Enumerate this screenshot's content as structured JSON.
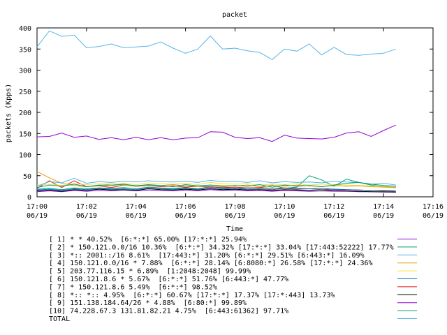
{
  "chart_data": {
    "type": "line",
    "title": "packet",
    "xlabel": "Time",
    "ylabel": "packets (Kpps)",
    "ylim": [
      0,
      400
    ],
    "yticks": [
      "0",
      "50",
      "100",
      "150",
      "200",
      "250",
      "300",
      "350",
      "400"
    ],
    "xlim": [
      "17:00",
      "17:16"
    ],
    "xticks": [
      {
        "time": "17:00",
        "date": "06/19"
      },
      {
        "time": "17:02",
        "date": "06/19"
      },
      {
        "time": "17:04",
        "date": "06/19"
      },
      {
        "time": "17:06",
        "date": "06/19"
      },
      {
        "time": "17:08",
        "date": "06/19"
      },
      {
        "time": "17:10",
        "date": "06/19"
      },
      {
        "time": "17:12",
        "date": "06/19"
      },
      {
        "time": "17:14",
        "date": "06/19"
      },
      {
        "time": "17:16",
        "date": "06/19"
      }
    ],
    "x": [
      "17:00:00",
      "17:00:30",
      "17:01:00",
      "17:01:30",
      "17:02:00",
      "17:02:30",
      "17:03:00",
      "17:03:30",
      "17:04:00",
      "17:04:30",
      "17:05:00",
      "17:05:30",
      "17:06:00",
      "17:06:30",
      "17:07:00",
      "17:07:30",
      "17:08:00",
      "17:08:30",
      "17:09:00",
      "17:09:30",
      "17:10:00",
      "17:10:30",
      "17:11:00",
      "17:11:30",
      "17:12:00",
      "17:12:30",
      "17:13:00",
      "17:13:30",
      "17:14:00",
      "17:14:30"
    ],
    "grid": false,
    "legend_position": "bottom",
    "series": [
      {
        "name": "[ 1] * * 40.52%  [6:*:*] 65.00% [17:*:*] 25.94%",
        "color": "#9400d3",
        "values": [
          142,
          143,
          151,
          141,
          144,
          136,
          140,
          135,
          141,
          135,
          140,
          135,
          139,
          140,
          154,
          153,
          141,
          138,
          140,
          131,
          146,
          139,
          138,
          137,
          141,
          151,
          154,
          143,
          157,
          170
        ]
      },
      {
        "name": "[ 2] * 150.121.0.0/16 10.36%  [6:*:*] 34.32% [17:*:*] 33.04% [17:443:52222] 17.77%",
        "color": "#009e73",
        "values": [
          22,
          28,
          25,
          30,
          24,
          28,
          27,
          30,
          26,
          29,
          27,
          24,
          29,
          26,
          28,
          24,
          27,
          25,
          29,
          23,
          28,
          25,
          27,
          24,
          28,
          32,
          34,
          30,
          27,
          25
        ]
      },
      {
        "name": "[ 3] *:: 2001::/16 8.61%  [17:443:*] 31.20% [6:*:*] 29.51% [6:443:*] 16.09%",
        "color": "#56b4e9",
        "values": [
          25,
          36,
          33,
          44,
          32,
          36,
          34,
          37,
          35,
          38,
          36,
          35,
          37,
          34,
          39,
          36,
          37,
          34,
          38,
          33,
          36,
          34,
          35,
          33,
          37,
          35,
          34,
          30,
          32,
          28
        ]
      },
      {
        "name": "[ 4] 150.121.0.0/16 * 7.88%  [6:*:*] 28.14% [6:8080:*] 26.58% [17:*:*] 24.36%",
        "color": "#e69f00",
        "values": [
          60,
          45,
          32,
          27,
          24,
          27,
          30,
          28,
          26,
          28,
          27,
          29,
          26,
          25,
          28,
          27,
          26,
          28,
          24,
          27,
          25,
          28,
          26,
          24,
          27,
          25,
          26,
          24,
          23,
          22
        ]
      },
      {
        "name": "[ 5] 203.77.116.15 * 6.89%  [1:2048:2048] 99.99%",
        "color": "#f0e442",
        "values": [
          28,
          30,
          27,
          31,
          29,
          31,
          30,
          32,
          29,
          33,
          31,
          30,
          32,
          29,
          34,
          31,
          30,
          31,
          28,
          30,
          29,
          31,
          28,
          30,
          29,
          28,
          27,
          26,
          25,
          24
        ]
      },
      {
        "name": "[ 6] 150.121.8.6 * 5.67%  [6:*:*] 51.76% [6:443:*] 47.77%",
        "color": "#0072b2",
        "values": [
          16,
          18,
          15,
          19,
          17,
          20,
          18,
          19,
          17,
          21,
          19,
          18,
          20,
          18,
          22,
          19,
          20,
          18,
          19,
          17,
          20,
          18,
          19,
          17,
          18,
          17,
          16,
          15,
          14,
          13
        ]
      },
      {
        "name": "[ 7] * 150.121.8.6 5.49%  [6:*:*] 98.52%",
        "color": "#e51e10",
        "values": [
          20,
          38,
          22,
          38,
          24,
          26,
          22,
          28,
          25,
          27,
          24,
          26,
          23,
          25,
          24,
          22,
          23,
          21,
          22,
          20,
          21,
          20,
          19,
          20,
          18,
          17,
          16,
          15,
          15,
          14
        ]
      },
      {
        "name": "[ 8] *:: *:: 4.95%  [6:*:*] 60.67% [17:*:*] 17.37% [17:*:443] 13.73%",
        "color": "#000000",
        "values": [
          14,
          16,
          13,
          17,
          15,
          18,
          16,
          17,
          15,
          19,
          17,
          16,
          18,
          16,
          19,
          17,
          18,
          16,
          17,
          15,
          17,
          16,
          15,
          14,
          16,
          14,
          13,
          12,
          12,
          11
        ]
      },
      {
        "name": "[ 9] 151.138.184.64/26 * 4.88%  [6:80:*] 99.89%",
        "color": "#9400d3",
        "values": [
          12,
          14,
          12,
          15,
          13,
          15,
          14,
          16,
          14,
          16,
          15,
          14,
          16,
          14,
          17,
          15,
          16,
          14,
          15,
          13,
          15,
          14,
          13,
          14,
          13,
          13,
          12,
          12,
          11,
          11
        ]
      },
      {
        "name": "[10] 74.228.67.3 131.81.82.21 4.75%  [6:443:61362] 97.71%",
        "color": "#009e73",
        "values": [
          18,
          20,
          17,
          21,
          19,
          21,
          20,
          22,
          19,
          23,
          21,
          20,
          22,
          19,
          24,
          21,
          20,
          21,
          22,
          28,
          20,
          23,
          50,
          40,
          25,
          42,
          34,
          28,
          24,
          22
        ]
      },
      {
        "name": "TOTAL",
        "color": "#56b4e9",
        "values": [
          355,
          393,
          380,
          383,
          353,
          356,
          362,
          353,
          355,
          357,
          367,
          352,
          340,
          350,
          381,
          350,
          352,
          346,
          342,
          325,
          350,
          345,
          362,
          336,
          354,
          337,
          335,
          338,
          340,
          350
        ]
      }
    ]
  }
}
